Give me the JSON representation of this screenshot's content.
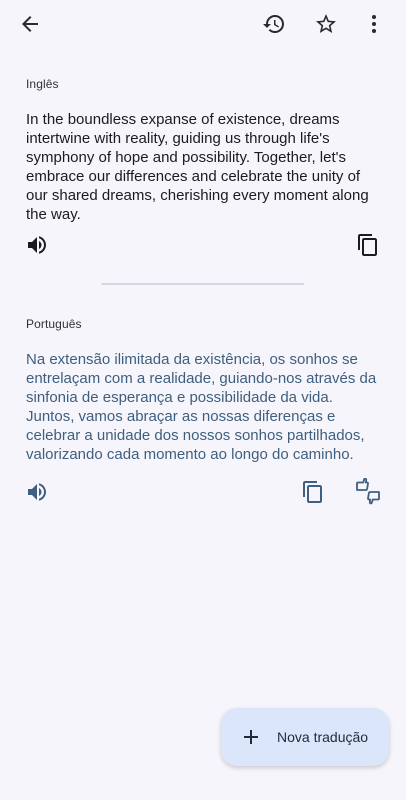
{
  "header": {
    "back_icon": "arrow-left-icon",
    "history_icon": "history-icon",
    "favorite_icon": "star-outline-icon",
    "more_icon": "more-vert-icon"
  },
  "source": {
    "language": "Inglês",
    "text": "In the boundless expanse of existence, dreams intertwine with reality, guiding us through life's symphony of hope and possibility. Together, let's embrace our differences and celebrate the unity of our shared dreams, cherishing every moment along the way.",
    "listen_icon": "volume-icon",
    "copy_icon": "copy-icon"
  },
  "target": {
    "language": "Português",
    "text": "Na extensão ilimitada da existência, os sonhos se entrelaçam com a realidade, guiando-nos através da sinfonia de esperança e possibilidade da vida. Juntos, vamos abraçar as nossas diferenças e celebrar a unidade dos nossos sonhos partilhados, valorizando cada momento ao longo do caminho.",
    "listen_icon": "volume-icon",
    "copy_icon": "copy-icon",
    "feedback_icon": "thumbs-up-down-icon",
    "text_color": "#3e5f7f"
  },
  "fab": {
    "label": "Nova tradução",
    "icon": "plus-icon",
    "background": "#dce6fa"
  }
}
